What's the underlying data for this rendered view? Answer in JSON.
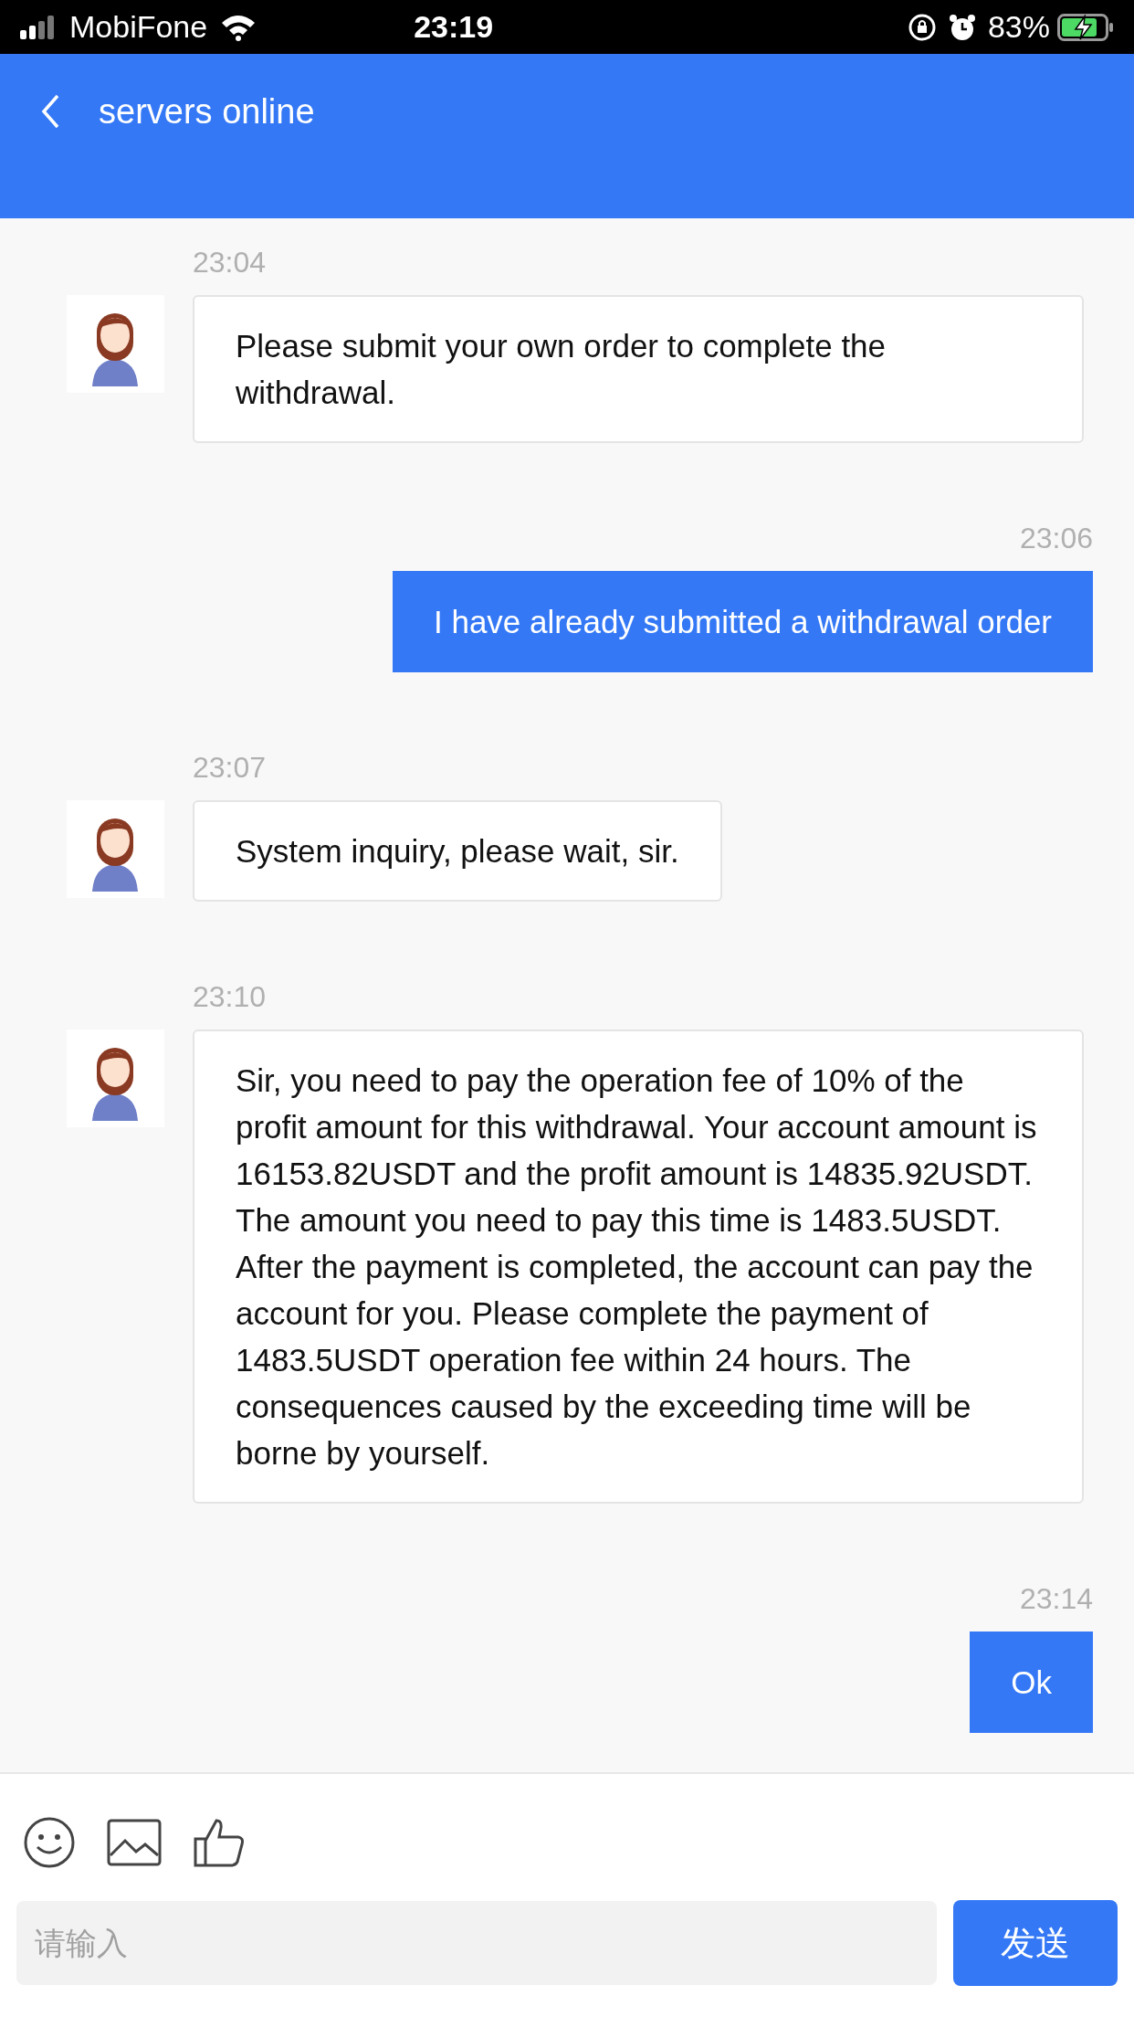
{
  "status_bar": {
    "carrier": "MobiFone",
    "time": "23:19",
    "battery": "83%"
  },
  "header": {
    "title": "servers online"
  },
  "messages": [
    {
      "kind": "received",
      "time": "23:04",
      "text": "Please submit your own order to complete the withdrawal."
    },
    {
      "kind": "sent",
      "time": "23:06",
      "text": "I have already submitted a withdrawal order"
    },
    {
      "kind": "received",
      "time": "23:07",
      "text": "System inquiry, please wait, sir."
    },
    {
      "kind": "received",
      "time": "23:10",
      "text": "Sir, you need to pay the operation fee of 10% of the profit amount for this withdrawal. Your account amount is 16153.82USDT and the profit amount is 14835.92USDT. The amount you need to pay this time is 1483.5USDT. After the payment is completed, the account can pay the account for you. Please complete the payment of 1483.5USDT operation fee within 24 hours. The consequences caused by the exceeding time will be borne by yourself."
    },
    {
      "kind": "sent",
      "time": "23:14",
      "text": "Ok"
    }
  ],
  "composer": {
    "placeholder": "请输入",
    "send": "发送"
  }
}
